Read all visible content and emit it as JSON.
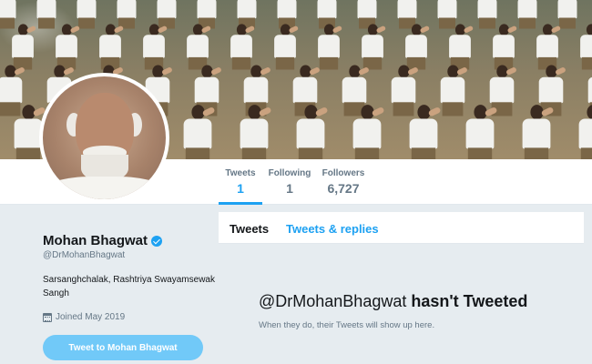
{
  "profile": {
    "name": "Mohan Bhagwat",
    "handle": "@DrMohanBhagwat",
    "bio": "Sarsanghchalak, Rashtriya Swayamsewak Sangh",
    "joined": "Joined May 2019",
    "tweet_to_button": "Tweet to Mohan Bhagwat",
    "verified": true
  },
  "stats": [
    {
      "label": "Tweets",
      "value": "1",
      "active": true
    },
    {
      "label": "Following",
      "value": "1",
      "active": false
    },
    {
      "label": "Followers",
      "value": "6,727",
      "active": false
    }
  ],
  "timeline": {
    "tabs": [
      {
        "label": "Tweets",
        "active": true
      },
      {
        "label": "Tweets & replies",
        "active": false
      }
    ],
    "empty_state": {
      "handle": "@DrMohanBhagwat",
      "message": "hasn't Tweeted",
      "subtext": "When they do, their Tweets will show up here."
    }
  },
  "colors": {
    "accent": "#1da1f2",
    "button": "#71c9f8",
    "background": "#e6ecf0",
    "muted_text": "#657786"
  },
  "icons": [
    "verified-badge-icon",
    "calendar-icon"
  ]
}
